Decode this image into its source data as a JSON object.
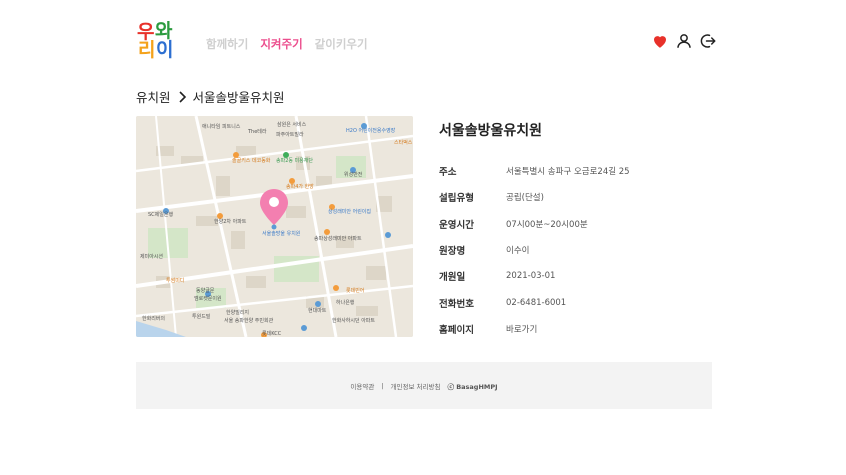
{
  "logo": {
    "char1": "우",
    "char2": "와",
    "char3": "리",
    "char4": "이"
  },
  "nav": {
    "items": [
      "함께하기",
      "지켜주기",
      "같이키우기"
    ],
    "active_index": 1
  },
  "header": {
    "icons": [
      "heart-icon",
      "user-icon",
      "logout-icon"
    ],
    "heart_color": "#e8312a"
  },
  "breadcrumb": {
    "root": "유치원",
    "current": "서울솔방울유치원"
  },
  "map": {
    "marker_label": "서울솔방울유치원",
    "labels": [
      "애니타임 피트니스",
      "The테라",
      "삼원은 서비스",
      "파주아트빌라",
      "H2O 어린이전용수영장",
      "스타벅스",
      "솔골키스 데코동화",
      "송파2동 미용재단",
      "송파4가 한방",
      "위성반전",
      "SC제일은행",
      "한양2차 아파트",
      "서울솔방울 유치원",
      "상성래미안 어린이집",
      "송파상성래미안 아파트",
      "투썸미디",
      "동양글문",
      "엠로켓문이원",
      "한양빌리지",
      "서울 송파한양 주민회관",
      "한화리버의",
      "투원드빌",
      "롯데빈어",
      "롯데KCC",
      "현대마트",
      "하나은행",
      "한화사하시던 아파트",
      "제미아시션"
    ]
  },
  "detail": {
    "title": "서울솔방울유치원",
    "rows": [
      {
        "label": "주소",
        "value": "서울특별시 송파구 오금로24길 25"
      },
      {
        "label": "설립유형",
        "value": "공립(단설)"
      },
      {
        "label": "운영시간",
        "value": "07시00분~20시00분"
      },
      {
        "label": "원장명",
        "value": "이수이"
      },
      {
        "label": "개원일",
        "value": "2021-03-01"
      },
      {
        "label": "전화번호",
        "value": "02-6481-6001"
      },
      {
        "label": "홈페이지",
        "value": "바로가기"
      }
    ]
  },
  "footer": {
    "terms": "이용약관",
    "divider": "|",
    "privacy": "개인정보 처리방침",
    "copyright": "ⓒ BasagHMPJ"
  },
  "colors": {
    "accent": "#ec4f8e",
    "marker": "#f37fb0",
    "map_bg": "#ece7dd"
  }
}
